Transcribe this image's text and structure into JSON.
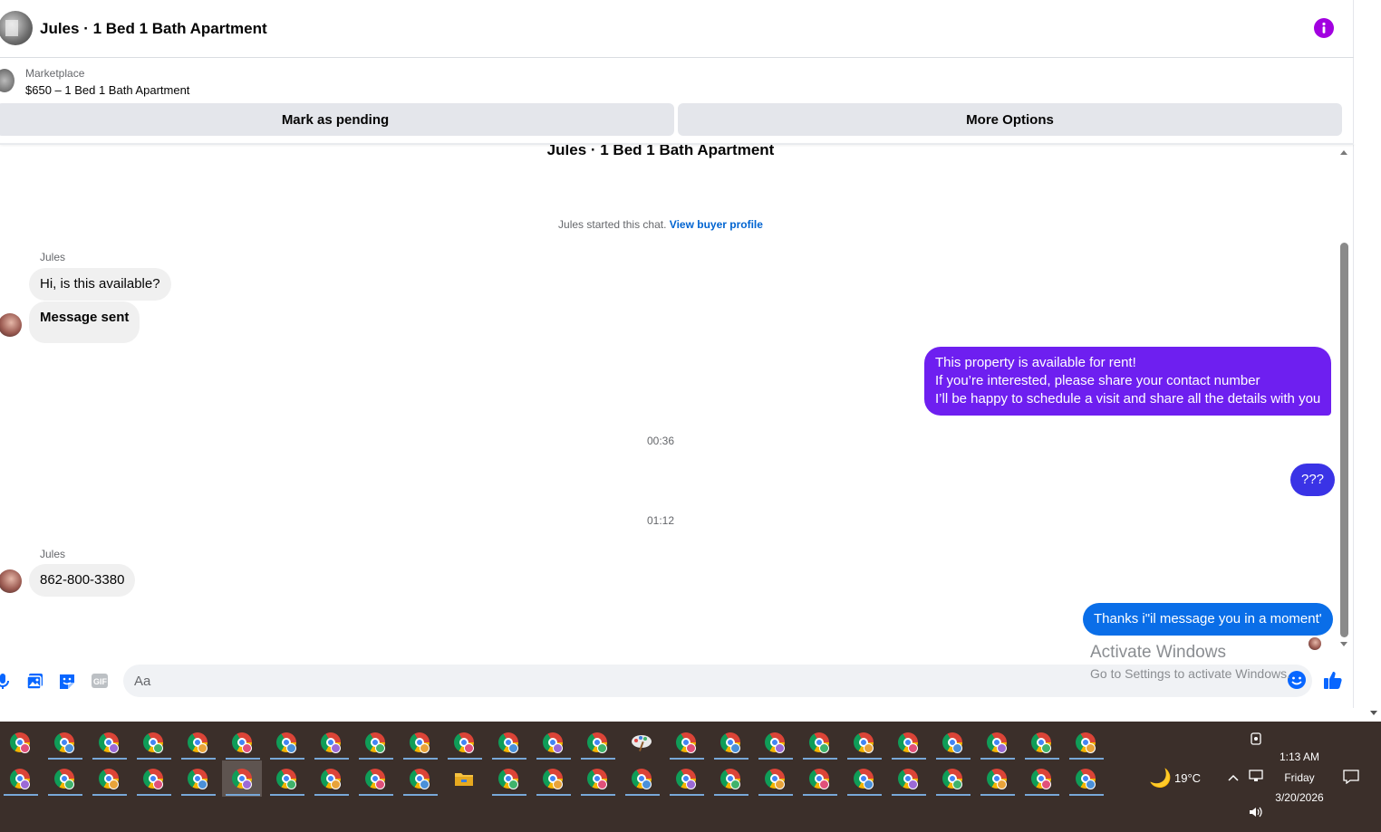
{
  "header": {
    "title": "Jules · 1 Bed 1 Bath Apartment",
    "info_icon": "info-icon",
    "accent": "#a200e0"
  },
  "marketplace": {
    "label": "Marketplace",
    "item": "$650 – 1 Bed 1 Bath Apartment"
  },
  "actions": {
    "pending_label": "Mark as pending",
    "more_label": "More Options"
  },
  "chat": {
    "top_title": "Jules · 1 Bed 1 Bath Apartment",
    "started_text": "Jules started this chat.",
    "view_profile": "View buyer profile",
    "messages": [
      {
        "sender": "Jules",
        "text": "Hi, is this available?",
        "direction": "in"
      },
      {
        "text": "Message sent",
        "direction": "in"
      },
      {
        "text_lines": [
          "This property is available for rent!",
          "If you’re interested, please share your contact number",
          "I’ll be happy to schedule a visit and share all the details with you"
        ],
        "direction": "out",
        "color": "#6e1ff0"
      },
      {
        "timestamp": "00:36"
      },
      {
        "text": "???",
        "direction": "out",
        "color": "#3a33e6"
      },
      {
        "timestamp": "01:12"
      },
      {
        "sender": "Jules",
        "text": "862-800-3380",
        "direction": "in"
      },
      {
        "text": "Thanks i\"il message you in a moment'",
        "direction": "out",
        "color": "#0a6ee8"
      }
    ]
  },
  "composer": {
    "placeholder": "Aa",
    "icons": [
      "microphone-icon",
      "image-icon",
      "sticker-icon",
      "gif-icon",
      "emoji-icon",
      "thumbs-up-icon"
    ]
  },
  "watermark": {
    "line1": "Activate Windows",
    "line2": "Go to Settings to activate Windows."
  },
  "taskbar": {
    "weather_temp": "19°C",
    "time": "1:13 AM",
    "day": "Friday",
    "date": "3/20/2026",
    "badge_colors": [
      "#e0507a",
      "#4a90d9",
      "#9b6ad6",
      "#3fb36b",
      "#e8a33a"
    ]
  }
}
